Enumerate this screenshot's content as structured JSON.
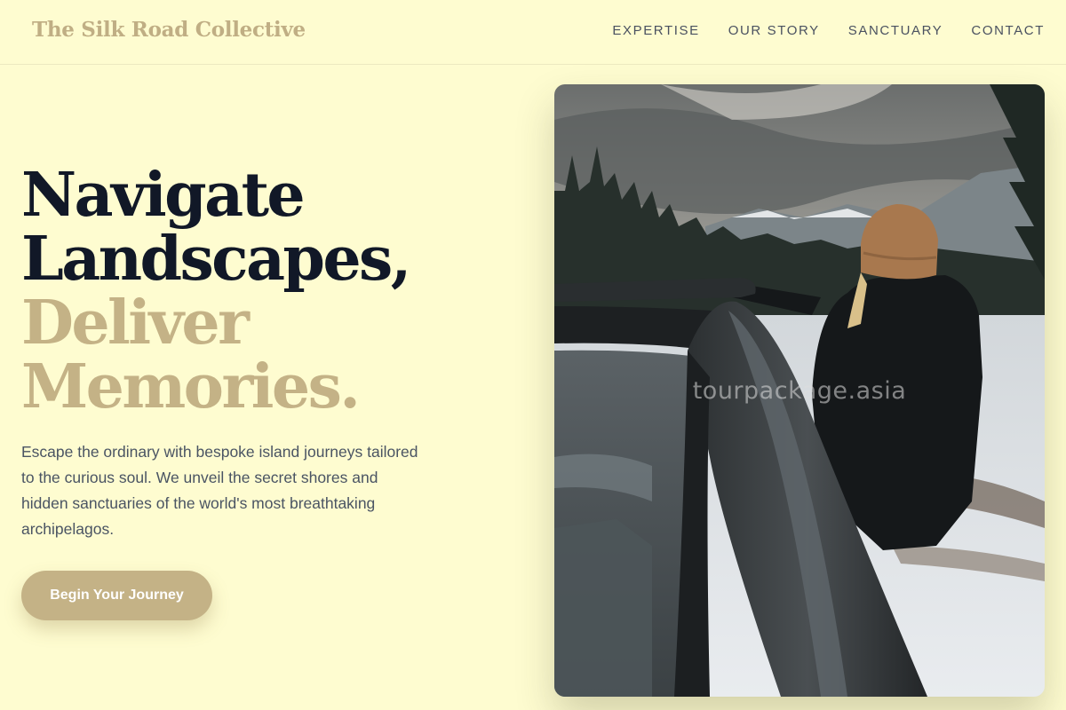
{
  "header": {
    "brand": "The Silk Road Collective",
    "nav": [
      "EXPERTISE",
      "OUR STORY",
      "SANCTUARY",
      "CONTACT"
    ]
  },
  "hero": {
    "title_line1": "Navigate",
    "title_line2": "Landscapes,",
    "title_line3": "Deliver",
    "title_line4": "Memories.",
    "description": "Escape the ordinary with bespoke island journeys tailored to the curious soul. We unveil the secret shores and hidden sanctuaries of the world's most breathtaking archipelagos.",
    "cta_label": "Begin Your Journey",
    "image_watermark": "tourpackage.asia"
  },
  "colors": {
    "background": "#fefcd0",
    "accent_gold": "#c4b286",
    "heading_dark": "#111827",
    "body_text": "#4a5463"
  }
}
